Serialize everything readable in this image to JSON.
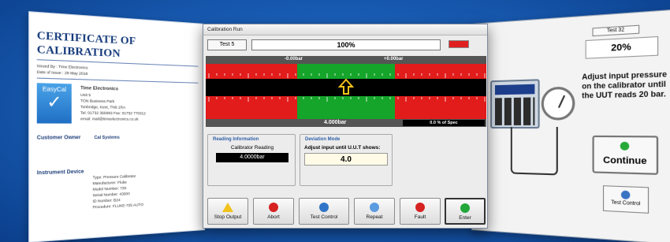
{
  "certificate": {
    "title": "CERTIFICATE OF CALIBRATION",
    "issued_by": "Issued By : Time Electronics",
    "date_of_issue": "Date of Issue : 29 May 2018",
    "logo_text": "EasyCal",
    "company": "Time Electronics",
    "address_lines": [
      "Unit 5",
      "TON Business Park",
      "Tonbridge, Kent, TN9 1RA",
      "Tel: 01732 355993 Fax: 01732 770312",
      "email: mail@timeelectronics.co.uk"
    ],
    "customer_label": "Customer Owner",
    "customer_name": "Cal Systems",
    "instrument_label": "Instrument Device",
    "instrument_rows": [
      {
        "label": "Type",
        "value": "Pressure Calibrator"
      },
      {
        "label": "Manufacturer",
        "value": "Fluke"
      },
      {
        "label": "Model Number",
        "value": "725"
      },
      {
        "label": "Serial Number",
        "value": "43000"
      },
      {
        "label": "ID Number",
        "value": "B24"
      },
      {
        "label": "Procedure",
        "value": "FLUKE-725 AUTO"
      }
    ]
  },
  "window": {
    "title": "Calibration Run",
    "test_label": "Test 5",
    "progress_text": "100%",
    "progress_fraction": 1.0,
    "alarm_color": "#e02020",
    "deviation": {
      "low_limit": "-0.00bar",
      "high_limit": "+0.00bar",
      "current_value": "4.000bar",
      "spec_text": "0.0 % of Spec"
    },
    "reading_info": {
      "title": "Reading Information",
      "sub": "Calibrator Reading",
      "value": "4.0000bar"
    },
    "deviation_mode": {
      "title": "Deviation Mode",
      "sub": "Adjust input until U.U.T shows:",
      "value": "4.0"
    },
    "buttons": [
      {
        "label": "Stop Output",
        "icon": "warning-icon"
      },
      {
        "label": "Abort",
        "icon": "abort-icon"
      },
      {
        "label": "Test Control",
        "icon": "test-control-icon"
      },
      {
        "label": "Repeat",
        "icon": "repeat-icon"
      },
      {
        "label": "Fault",
        "icon": "fault-icon"
      },
      {
        "label": "Enter",
        "icon": "enter-icon"
      }
    ]
  },
  "right_screen": {
    "test_label": "Test 32",
    "progress_text": "20%",
    "instruction": "Adjust input pressure on the calibrator until the UUT reads 20 bar.",
    "continue_label": "Continue",
    "test_control_label": "Test Control"
  },
  "colors": {
    "red_zone": "#e21b1b",
    "green_zone": "#14a52a",
    "background": "#1a5fb8"
  }
}
